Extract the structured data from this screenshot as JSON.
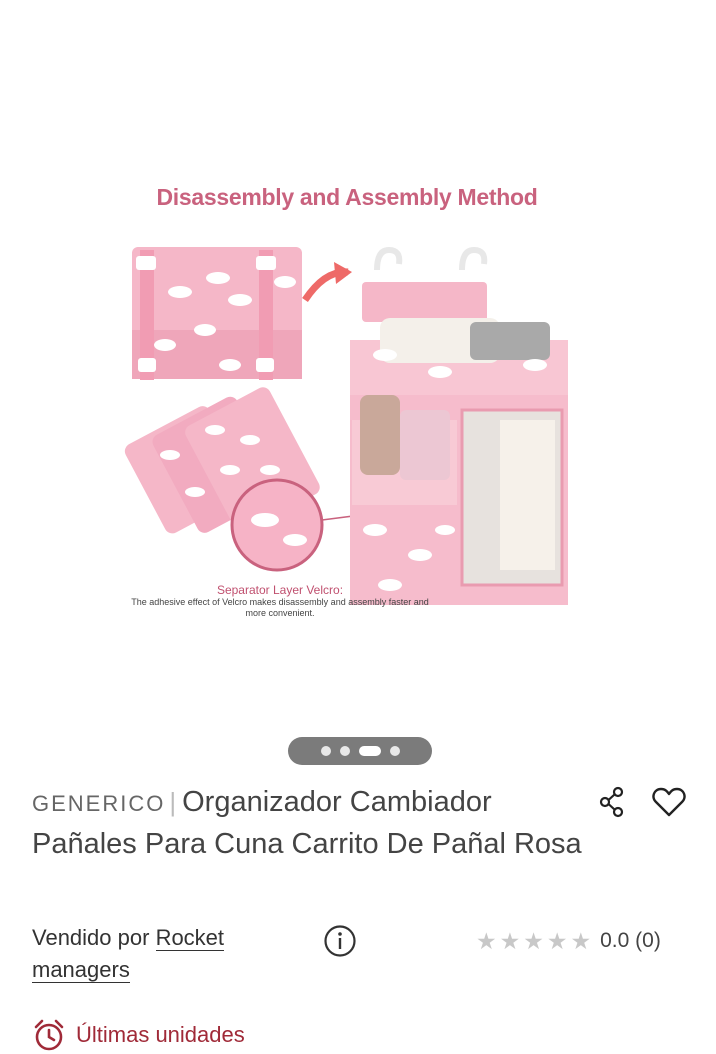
{
  "gallery": {
    "headline": "Disassembly and Assembly Method",
    "caption_title": "Separator Layer Velcro:",
    "caption_text": "The adhesive effect of Velcro makes disassembly and assembly faster and more convenient.",
    "slide_count": 4,
    "active_slide": 3
  },
  "product": {
    "brand": "GENERICO",
    "separator": "|",
    "title": "Organizador Cambiador Pañales Para Cuna Carrito De Pañal Rosa"
  },
  "seller": {
    "prefix": "Vendido por",
    "name": "Rocket managers"
  },
  "rating": {
    "value": "0.0",
    "count": "(0)",
    "stars_filled": 0,
    "stars_total": 5
  },
  "stock": {
    "label": "Últimas unidades"
  },
  "colors": {
    "accent_pink": "#c9627e",
    "alert_red": "#a02a38",
    "star_empty": "#c8c8c8"
  },
  "icons": [
    "share-icon",
    "heart-icon",
    "info-icon",
    "star-icon",
    "alarm-clock-icon"
  ]
}
